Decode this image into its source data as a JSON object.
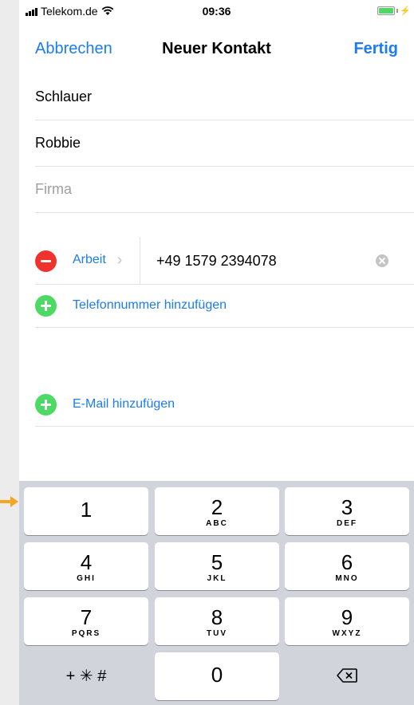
{
  "status_bar": {
    "carrier": "Telekom.de",
    "time": "09:36"
  },
  "nav": {
    "cancel": "Abbrechen",
    "title": "Neuer Kontakt",
    "done": "Fertig"
  },
  "fields": {
    "last_name": "Schlauer",
    "first_name": "Robbie",
    "company_placeholder": "Firma"
  },
  "phone": {
    "label": "Arbeit",
    "number": "+49 1579 2394078"
  },
  "add_phone_label": "Telefonnummer hinzufügen",
  "add_email_label": "E-Mail hinzufügen",
  "keypad": {
    "keys": [
      {
        "digit": "1",
        "letters": ""
      },
      {
        "digit": "2",
        "letters": "ABC"
      },
      {
        "digit": "3",
        "letters": "DEF"
      },
      {
        "digit": "4",
        "letters": "GHI"
      },
      {
        "digit": "5",
        "letters": "JKL"
      },
      {
        "digit": "6",
        "letters": "MNO"
      },
      {
        "digit": "7",
        "letters": "PQRS"
      },
      {
        "digit": "8",
        "letters": "TUV"
      },
      {
        "digit": "9",
        "letters": "WXYZ"
      },
      {
        "digit": "0",
        "letters": ""
      }
    ],
    "symbols": "+ ✳︎ #"
  },
  "colors": {
    "accent": "#1c7cf4",
    "delete_red": "#f0322c",
    "add_green": "#4cd964",
    "keyboard_bg": "#d1d5db",
    "pointer_arrow": "#f5a623"
  }
}
